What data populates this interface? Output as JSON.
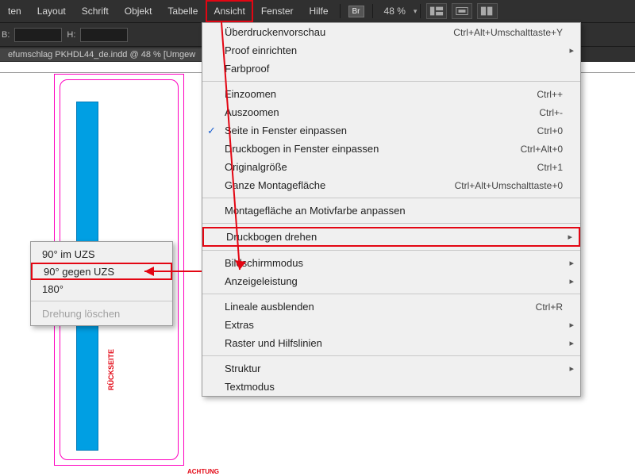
{
  "menubar": {
    "items": [
      "ten",
      "Layout",
      "Schrift",
      "Objekt",
      "Tabelle",
      "Ansicht",
      "Fenster",
      "Hilfe"
    ],
    "br_label": "Br",
    "zoom_pct": "48 %",
    "dropdown_glyph": "▾"
  },
  "toolbar2": {
    "glyph_b": "B:",
    "glyph_h": "H:"
  },
  "tab": {
    "title": "efumschlag PKHDL44_de.indd @ 48 % [Umgew"
  },
  "dropdown": {
    "items": [
      {
        "label": "Überdruckenvorschau",
        "sc": "Ctrl+Alt+Umschalttaste+Y"
      },
      {
        "label": "Proof einrichten",
        "sub": true
      },
      {
        "label": "Farbproof"
      },
      {
        "sep": true
      },
      {
        "label": "Einzoomen",
        "sc": "Ctrl++"
      },
      {
        "label": "Auszoomen",
        "sc": "Ctrl+-"
      },
      {
        "label": "Seite in Fenster einpassen",
        "sc": "Ctrl+0",
        "chk": true
      },
      {
        "label": "Druckbogen in Fenster einpassen",
        "sc": "Ctrl+Alt+0"
      },
      {
        "label": "Originalgröße",
        "sc": "Ctrl+1"
      },
      {
        "label": "Ganze Montagefläche",
        "sc": "Ctrl+Alt+Umschalttaste+0"
      },
      {
        "sep": true
      },
      {
        "label": "Montagefläche an Motivfarbe anpassen"
      },
      {
        "sep": true
      },
      {
        "label": "Druckbogen drehen",
        "sub": true,
        "hl": true
      },
      {
        "sep": true
      },
      {
        "label": "Bildschirmmodus",
        "sub": true
      },
      {
        "label": "Anzeigeleistung",
        "sub": true
      },
      {
        "sep": true
      },
      {
        "label": "Lineale ausblenden",
        "sc": "Ctrl+R"
      },
      {
        "label": "Extras",
        "sub": true
      },
      {
        "label": "Raster und Hilfslinien",
        "sub": true
      },
      {
        "sep": true
      },
      {
        "label": "Struktur",
        "sub": true
      },
      {
        "label": "Textmodus"
      }
    ]
  },
  "submenu": {
    "items": [
      {
        "label": "90° im UZS"
      },
      {
        "label": "90° gegen UZS",
        "sel": true
      },
      {
        "label": "180°"
      },
      {
        "sep": true
      },
      {
        "label": "Drehung löschen",
        "dis": true
      }
    ]
  },
  "canvas": {
    "rueckseite": "RÜCKSEITE",
    "achtung": "ACHTUNG"
  }
}
